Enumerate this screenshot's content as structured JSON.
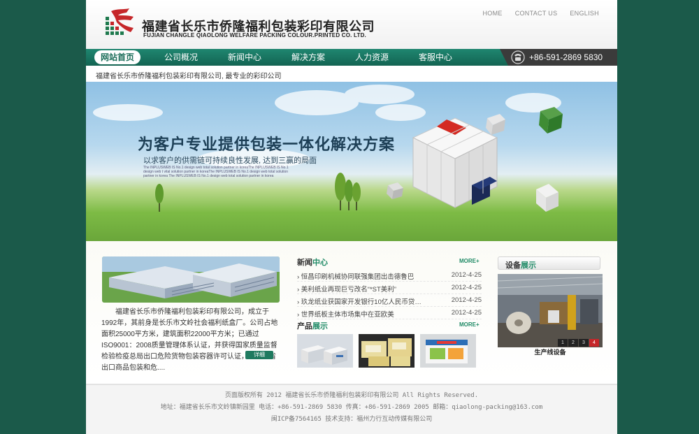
{
  "header": {
    "company_cn": "福建省长乐市侨隆福利包装彩印有限公司",
    "company_en": "FUJIAN CHANGLE QIAOLONG WELFARE PACKING COLOUR.PRINTED CO. LTD.",
    "links": [
      "HOME",
      "CONTACT US",
      "ENGLISH"
    ]
  },
  "nav": {
    "items": [
      "网站首页",
      "公司概况",
      "新闻中心",
      "解决方案",
      "人力资源",
      "客服中心"
    ],
    "phone": "+86-591-2869 5830"
  },
  "slogan": "福建省长乐市侨隆福利包装彩印有限公司, 最专业的彩印公司",
  "banner": {
    "title": "为客户专业提供包装一体化解决方案",
    "subtitle": "以求客户的供需链可持续良性发展, 达到三赢的局面",
    "fine_print": "The INPLUSWEB IS No.1 design web total solution partner in koreaThe INPLUSWEB IS No.1 design web t vital solution partner in koreaThe INPLUSWEB IS No.1 design web total solution partner in korea The INPLUSWEB IS No.1 design web total solution partner in korea"
  },
  "about": {
    "text": "福建省长乐市侨隆福利包装彩印有限公司，成立于1992年，其前身是长乐市文岭社会福利纸盒厂。公司占地面积25000平方米，建筑面积22000平方米；已通过ISO9001：2008质量管理体系认证，并获得国家质量监督检验检疫总局出口危险货物包装容器许可认证，是福建省出口商品包装和危....",
    "detail_label": "详细"
  },
  "news": {
    "title_a": "新闻",
    "title_b": "中心",
    "more": "MORE+",
    "items": [
      {
        "title": "› 恒昌印刷机械协同联强集团出击德鲁巴",
        "date": "2012-4-25"
      },
      {
        "title": "› 美利纸业再现巨亏改名“*ST美利”",
        "date": "2012-4-25"
      },
      {
        "title": "› 玖龙纸业获国家开发银行10亿人民币贷…",
        "date": "2012-4-25"
      },
      {
        "title": "› 世界纸板主体市场集中在亚欧美",
        "date": "2012-4-25"
      }
    ]
  },
  "products": {
    "title_a": "产品",
    "title_b": "展示",
    "more": "MORE+"
  },
  "equipment": {
    "title_a": "设备",
    "title_b": "展示",
    "caption": "生产线设备",
    "slides": [
      "1",
      "2",
      "3",
      "4"
    ],
    "active_slide": 4
  },
  "footer": {
    "line1": "页面版权所有 2012 福建省长乐市侨隆福利包装彩印有限公司 All Rights Reserved.",
    "line2": "地址：福建省长乐市文岭镇新园里 电话：+86-591-2869 5830 传真：+86-591-2869 2005 邮箱：qiaolong-packing@163.com",
    "line3": "闽ICP备7564165 技术支持：福州力行互动传媒有限公司"
  },
  "colors": {
    "brand_green": "#1f8670",
    "page_bg": "#1b5a4a",
    "accent_red": "#c6272a"
  }
}
